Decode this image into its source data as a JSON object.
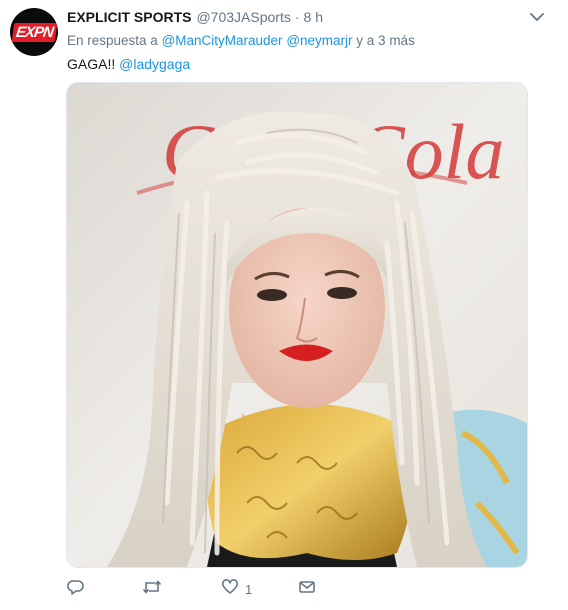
{
  "tweet": {
    "avatar_text_left": "EXP",
    "avatar_text_right": "N",
    "display_name": "EXPLICIT SPORTS",
    "handle": "@703JASports",
    "separator": "·",
    "time": "8 h",
    "reply_prefix": "En respuesta a ",
    "reply_mention_1": "@ManCityMarauder",
    "reply_space": " ",
    "reply_mention_2": "@neymarjr",
    "reply_suffix": " y a 3 más",
    "text_prefix": "GAGA!! ",
    "text_mention": "@ladygaga",
    "media_backdrop_text": "Coca-Cola",
    "actions": {
      "reply_count": "",
      "retweet_count": "",
      "like_count": "1",
      "dm_count": ""
    }
  },
  "colors": {
    "accent": "#1b95e0",
    "secondary_text": "#657786",
    "primary_text": "#14171a",
    "brand_red": "#e41e26"
  },
  "icons": {
    "menu": "chevron-down-icon",
    "reply": "reply-icon",
    "retweet": "retweet-icon",
    "like": "heart-icon",
    "dm": "envelope-icon"
  }
}
